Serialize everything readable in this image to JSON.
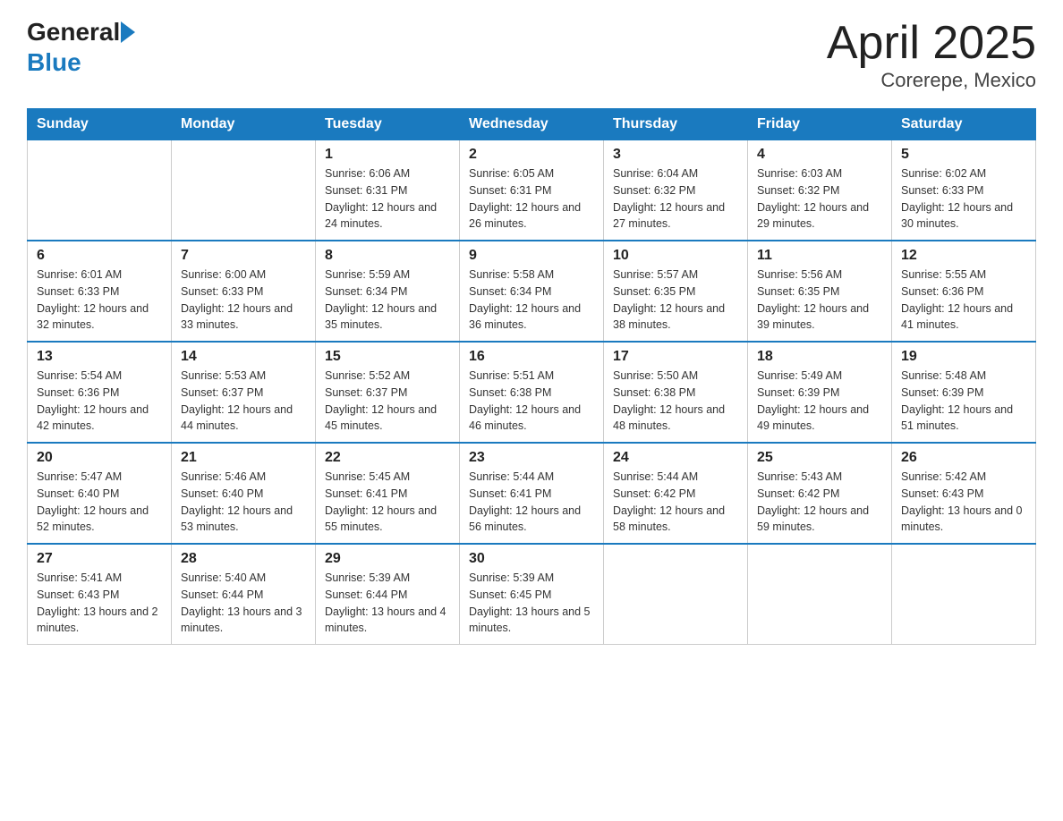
{
  "header": {
    "logo_general": "General",
    "logo_blue": "Blue",
    "month_year": "April 2025",
    "location": "Corerepe, Mexico"
  },
  "days_of_week": [
    "Sunday",
    "Monday",
    "Tuesday",
    "Wednesday",
    "Thursday",
    "Friday",
    "Saturday"
  ],
  "weeks": [
    [
      {
        "day": "",
        "sunrise": "",
        "sunset": "",
        "daylight": ""
      },
      {
        "day": "",
        "sunrise": "",
        "sunset": "",
        "daylight": ""
      },
      {
        "day": "1",
        "sunrise": "Sunrise: 6:06 AM",
        "sunset": "Sunset: 6:31 PM",
        "daylight": "Daylight: 12 hours and 24 minutes."
      },
      {
        "day": "2",
        "sunrise": "Sunrise: 6:05 AM",
        "sunset": "Sunset: 6:31 PM",
        "daylight": "Daylight: 12 hours and 26 minutes."
      },
      {
        "day": "3",
        "sunrise": "Sunrise: 6:04 AM",
        "sunset": "Sunset: 6:32 PM",
        "daylight": "Daylight: 12 hours and 27 minutes."
      },
      {
        "day": "4",
        "sunrise": "Sunrise: 6:03 AM",
        "sunset": "Sunset: 6:32 PM",
        "daylight": "Daylight: 12 hours and 29 minutes."
      },
      {
        "day": "5",
        "sunrise": "Sunrise: 6:02 AM",
        "sunset": "Sunset: 6:33 PM",
        "daylight": "Daylight: 12 hours and 30 minutes."
      }
    ],
    [
      {
        "day": "6",
        "sunrise": "Sunrise: 6:01 AM",
        "sunset": "Sunset: 6:33 PM",
        "daylight": "Daylight: 12 hours and 32 minutes."
      },
      {
        "day": "7",
        "sunrise": "Sunrise: 6:00 AM",
        "sunset": "Sunset: 6:33 PM",
        "daylight": "Daylight: 12 hours and 33 minutes."
      },
      {
        "day": "8",
        "sunrise": "Sunrise: 5:59 AM",
        "sunset": "Sunset: 6:34 PM",
        "daylight": "Daylight: 12 hours and 35 minutes."
      },
      {
        "day": "9",
        "sunrise": "Sunrise: 5:58 AM",
        "sunset": "Sunset: 6:34 PM",
        "daylight": "Daylight: 12 hours and 36 minutes."
      },
      {
        "day": "10",
        "sunrise": "Sunrise: 5:57 AM",
        "sunset": "Sunset: 6:35 PM",
        "daylight": "Daylight: 12 hours and 38 minutes."
      },
      {
        "day": "11",
        "sunrise": "Sunrise: 5:56 AM",
        "sunset": "Sunset: 6:35 PM",
        "daylight": "Daylight: 12 hours and 39 minutes."
      },
      {
        "day": "12",
        "sunrise": "Sunrise: 5:55 AM",
        "sunset": "Sunset: 6:36 PM",
        "daylight": "Daylight: 12 hours and 41 minutes."
      }
    ],
    [
      {
        "day": "13",
        "sunrise": "Sunrise: 5:54 AM",
        "sunset": "Sunset: 6:36 PM",
        "daylight": "Daylight: 12 hours and 42 minutes."
      },
      {
        "day": "14",
        "sunrise": "Sunrise: 5:53 AM",
        "sunset": "Sunset: 6:37 PM",
        "daylight": "Daylight: 12 hours and 44 minutes."
      },
      {
        "day": "15",
        "sunrise": "Sunrise: 5:52 AM",
        "sunset": "Sunset: 6:37 PM",
        "daylight": "Daylight: 12 hours and 45 minutes."
      },
      {
        "day": "16",
        "sunrise": "Sunrise: 5:51 AM",
        "sunset": "Sunset: 6:38 PM",
        "daylight": "Daylight: 12 hours and 46 minutes."
      },
      {
        "day": "17",
        "sunrise": "Sunrise: 5:50 AM",
        "sunset": "Sunset: 6:38 PM",
        "daylight": "Daylight: 12 hours and 48 minutes."
      },
      {
        "day": "18",
        "sunrise": "Sunrise: 5:49 AM",
        "sunset": "Sunset: 6:39 PM",
        "daylight": "Daylight: 12 hours and 49 minutes."
      },
      {
        "day": "19",
        "sunrise": "Sunrise: 5:48 AM",
        "sunset": "Sunset: 6:39 PM",
        "daylight": "Daylight: 12 hours and 51 minutes."
      }
    ],
    [
      {
        "day": "20",
        "sunrise": "Sunrise: 5:47 AM",
        "sunset": "Sunset: 6:40 PM",
        "daylight": "Daylight: 12 hours and 52 minutes."
      },
      {
        "day": "21",
        "sunrise": "Sunrise: 5:46 AM",
        "sunset": "Sunset: 6:40 PM",
        "daylight": "Daylight: 12 hours and 53 minutes."
      },
      {
        "day": "22",
        "sunrise": "Sunrise: 5:45 AM",
        "sunset": "Sunset: 6:41 PM",
        "daylight": "Daylight: 12 hours and 55 minutes."
      },
      {
        "day": "23",
        "sunrise": "Sunrise: 5:44 AM",
        "sunset": "Sunset: 6:41 PM",
        "daylight": "Daylight: 12 hours and 56 minutes."
      },
      {
        "day": "24",
        "sunrise": "Sunrise: 5:44 AM",
        "sunset": "Sunset: 6:42 PM",
        "daylight": "Daylight: 12 hours and 58 minutes."
      },
      {
        "day": "25",
        "sunrise": "Sunrise: 5:43 AM",
        "sunset": "Sunset: 6:42 PM",
        "daylight": "Daylight: 12 hours and 59 minutes."
      },
      {
        "day": "26",
        "sunrise": "Sunrise: 5:42 AM",
        "sunset": "Sunset: 6:43 PM",
        "daylight": "Daylight: 13 hours and 0 minutes."
      }
    ],
    [
      {
        "day": "27",
        "sunrise": "Sunrise: 5:41 AM",
        "sunset": "Sunset: 6:43 PM",
        "daylight": "Daylight: 13 hours and 2 minutes."
      },
      {
        "day": "28",
        "sunrise": "Sunrise: 5:40 AM",
        "sunset": "Sunset: 6:44 PM",
        "daylight": "Daylight: 13 hours and 3 minutes."
      },
      {
        "day": "29",
        "sunrise": "Sunrise: 5:39 AM",
        "sunset": "Sunset: 6:44 PM",
        "daylight": "Daylight: 13 hours and 4 minutes."
      },
      {
        "day": "30",
        "sunrise": "Sunrise: 5:39 AM",
        "sunset": "Sunset: 6:45 PM",
        "daylight": "Daylight: 13 hours and 5 minutes."
      },
      {
        "day": "",
        "sunrise": "",
        "sunset": "",
        "daylight": ""
      },
      {
        "day": "",
        "sunrise": "",
        "sunset": "",
        "daylight": ""
      },
      {
        "day": "",
        "sunrise": "",
        "sunset": "",
        "daylight": ""
      }
    ]
  ]
}
